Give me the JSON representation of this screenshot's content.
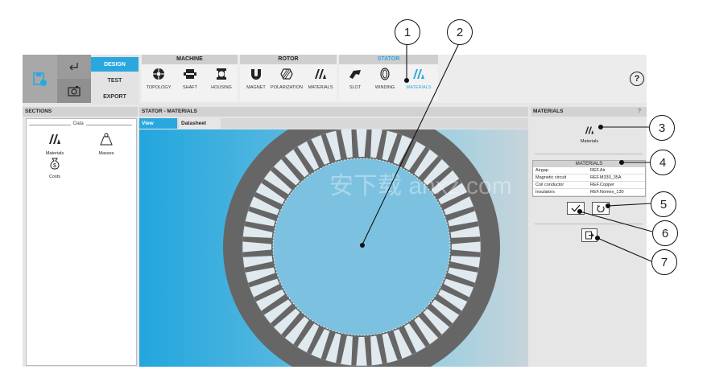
{
  "modes": [
    "DESIGN",
    "TEST",
    "EXPORT"
  ],
  "groups": {
    "machine": {
      "title": "MACHINE",
      "tools": [
        "TOPOLOGY",
        "SHAFT",
        "HOUSING"
      ]
    },
    "rotor": {
      "title": "ROTOR",
      "tools": [
        "MAGNET",
        "POLARIZATION",
        "MATERIALS"
      ]
    },
    "stator": {
      "title": "STATOR",
      "tools": [
        "SLOT",
        "WINDING",
        "MATERIALS"
      ]
    }
  },
  "help_label": "?",
  "sections": {
    "title": "SECTIONS",
    "group_label": "Data",
    "items": [
      "Materials",
      "Masses",
      "Costs"
    ]
  },
  "center": {
    "title": "STATOR - MATERIALS",
    "tabs": [
      "View",
      "Datasheet"
    ],
    "watermark": "安下载 anxz.com"
  },
  "materials_panel": {
    "title": "MATERIALS",
    "help": "?",
    "icon_label": "Materials",
    "table_title": "MATERIALS",
    "rows": [
      {
        "name": "Airgap",
        "value": "REF.Air"
      },
      {
        "name": "Magnetic circuit",
        "value": "REF.M330_35A"
      },
      {
        "name": "Coil conductor",
        "value": "REF.Copper"
      },
      {
        "name": "Insulators",
        "value": "REF.Nomex_130"
      }
    ]
  },
  "callouts": [
    "1",
    "2",
    "3",
    "4",
    "5",
    "6",
    "7"
  ],
  "colors": {
    "accent": "#2aa7df",
    "stator": "#666666",
    "toolbar_dark": "#9b9b9b"
  }
}
